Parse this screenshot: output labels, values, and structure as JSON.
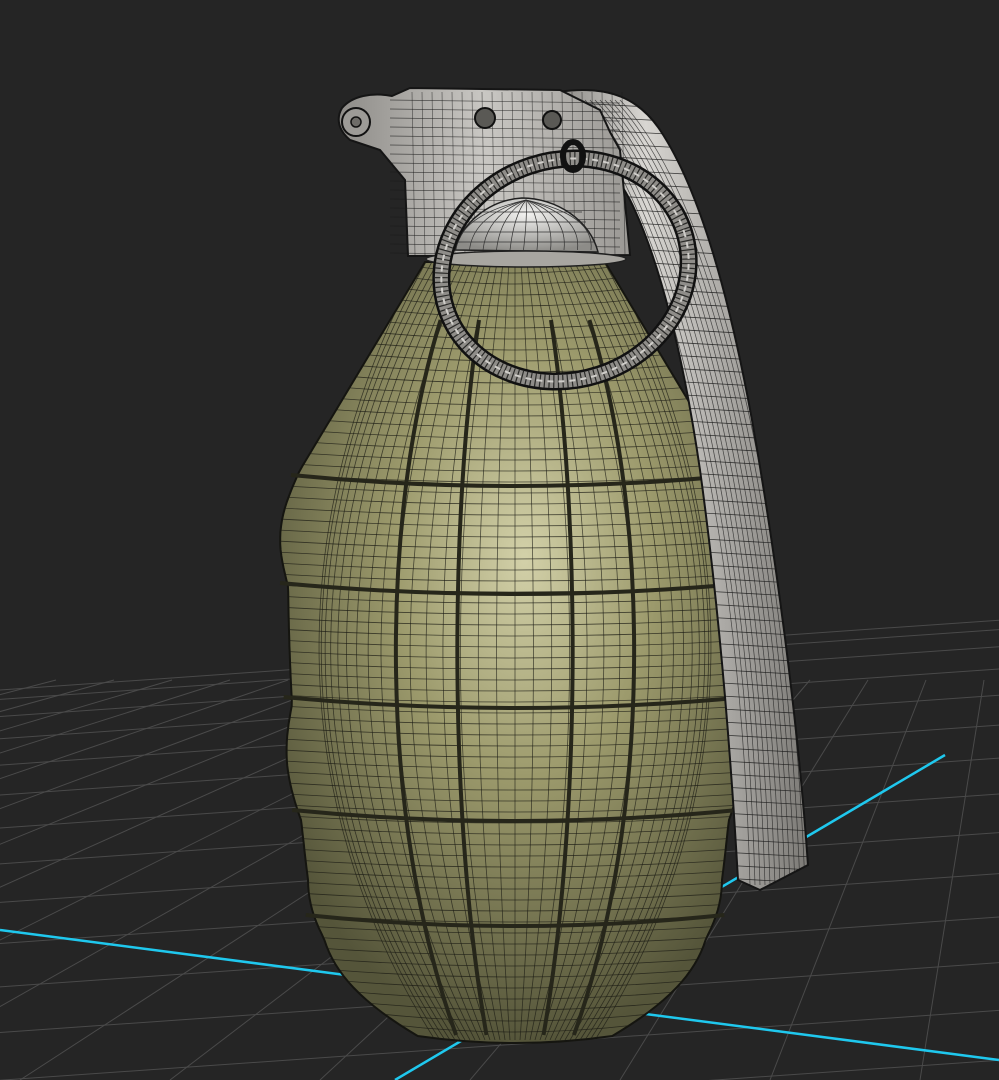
{
  "viewport": {
    "background_color": "#252525",
    "grid_color": "#4a4a4a",
    "axis_color": "#1fc8ee"
  },
  "model": {
    "object": "grenade-icon",
    "display_mode": "wireframe-on-shaded",
    "body_color": "#8a8a5e",
    "body_highlight_color": "#c9c8a0",
    "body_shadow_color": "#5d5d3c",
    "metal_color": "#b9b7b2",
    "metal_shadow_color": "#6f6d68",
    "wire_color": "#1b1b14"
  }
}
